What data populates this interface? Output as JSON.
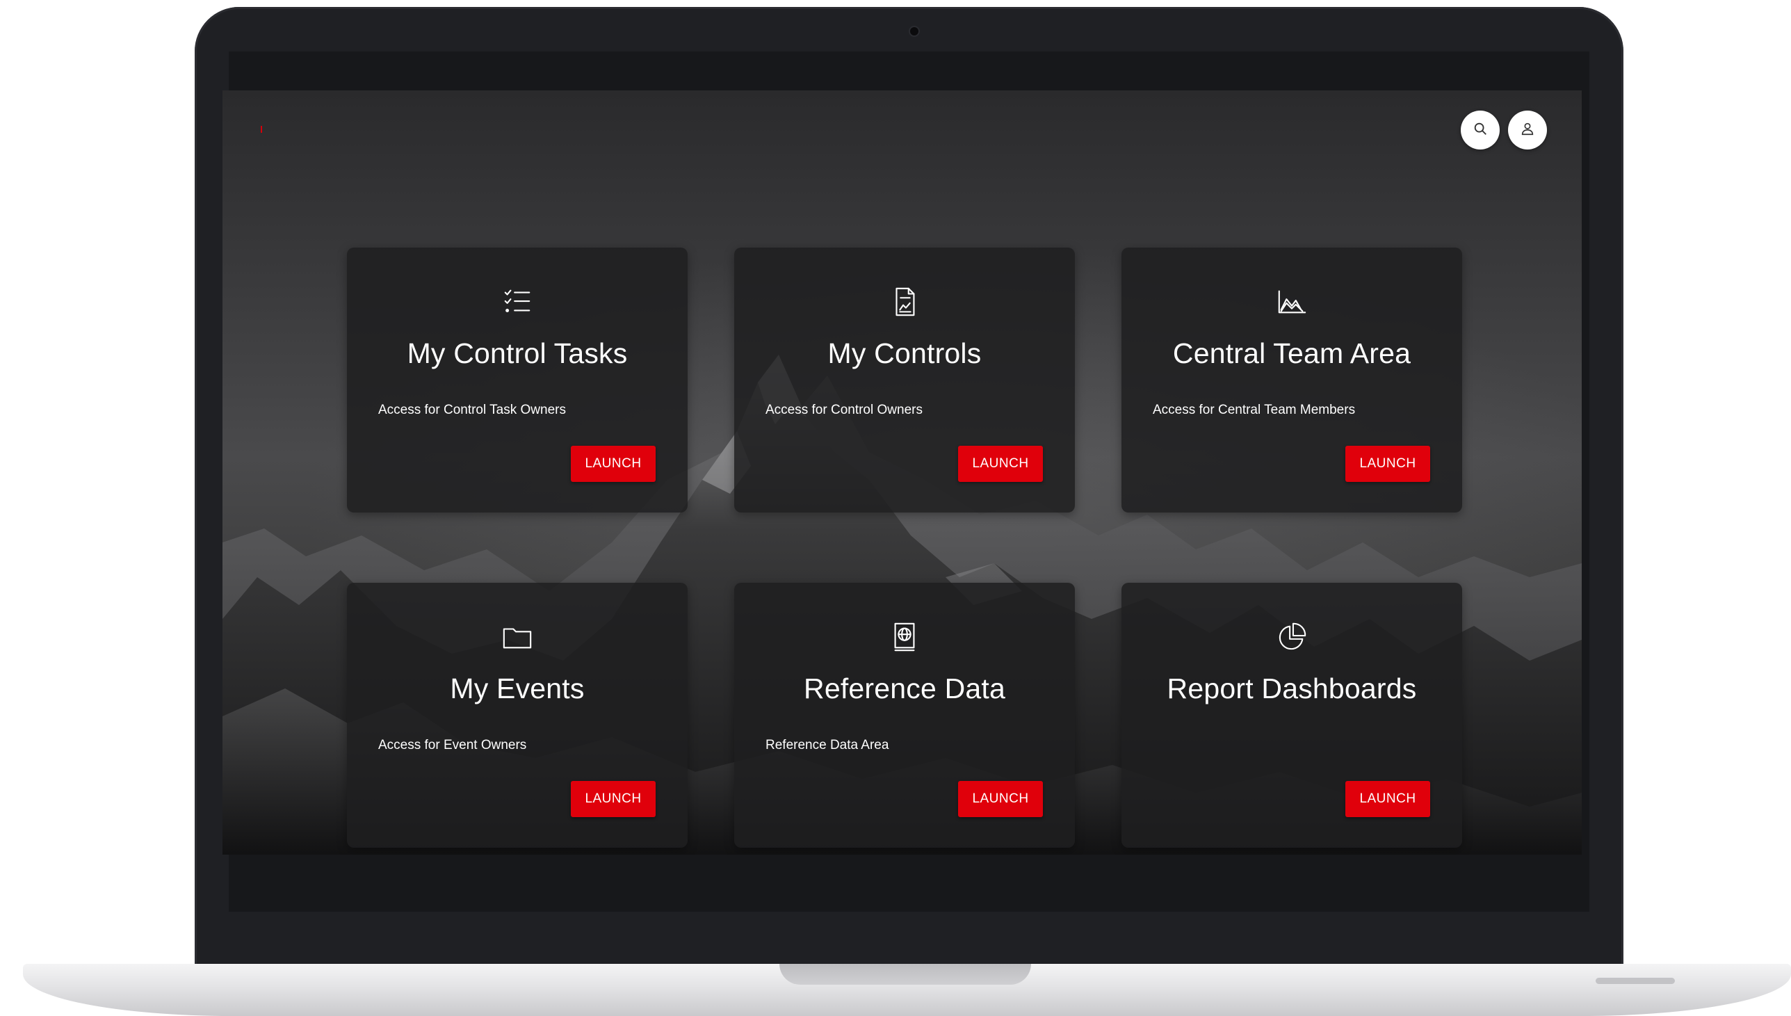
{
  "header": {
    "search_icon": "search-icon",
    "user_icon": "user-icon"
  },
  "colors": {
    "accent": "#e0000b",
    "card_bg": "#1e1e20",
    "text": "#ffffff"
  },
  "cards": [
    {
      "icon": "checklist-icon",
      "title": "My Control Tasks",
      "description": "Access for Control Task Owners",
      "button": "LAUNCH"
    },
    {
      "icon": "document-chart-icon",
      "title": "My Controls",
      "description": "Access for Control Owners",
      "button": "LAUNCH"
    },
    {
      "icon": "area-chart-icon",
      "title": "Central Team Area",
      "description": "Access for Central Team Members",
      "button": "LAUNCH"
    },
    {
      "icon": "folder-icon",
      "title": "My Events",
      "description": "Access for Event Owners",
      "button": "LAUNCH"
    },
    {
      "icon": "globe-book-icon",
      "title": "Reference Data",
      "description": "Reference Data Area",
      "button": "LAUNCH"
    },
    {
      "icon": "pie-chart-icon",
      "title": "Report Dashboards",
      "description": "",
      "button": "LAUNCH"
    }
  ]
}
